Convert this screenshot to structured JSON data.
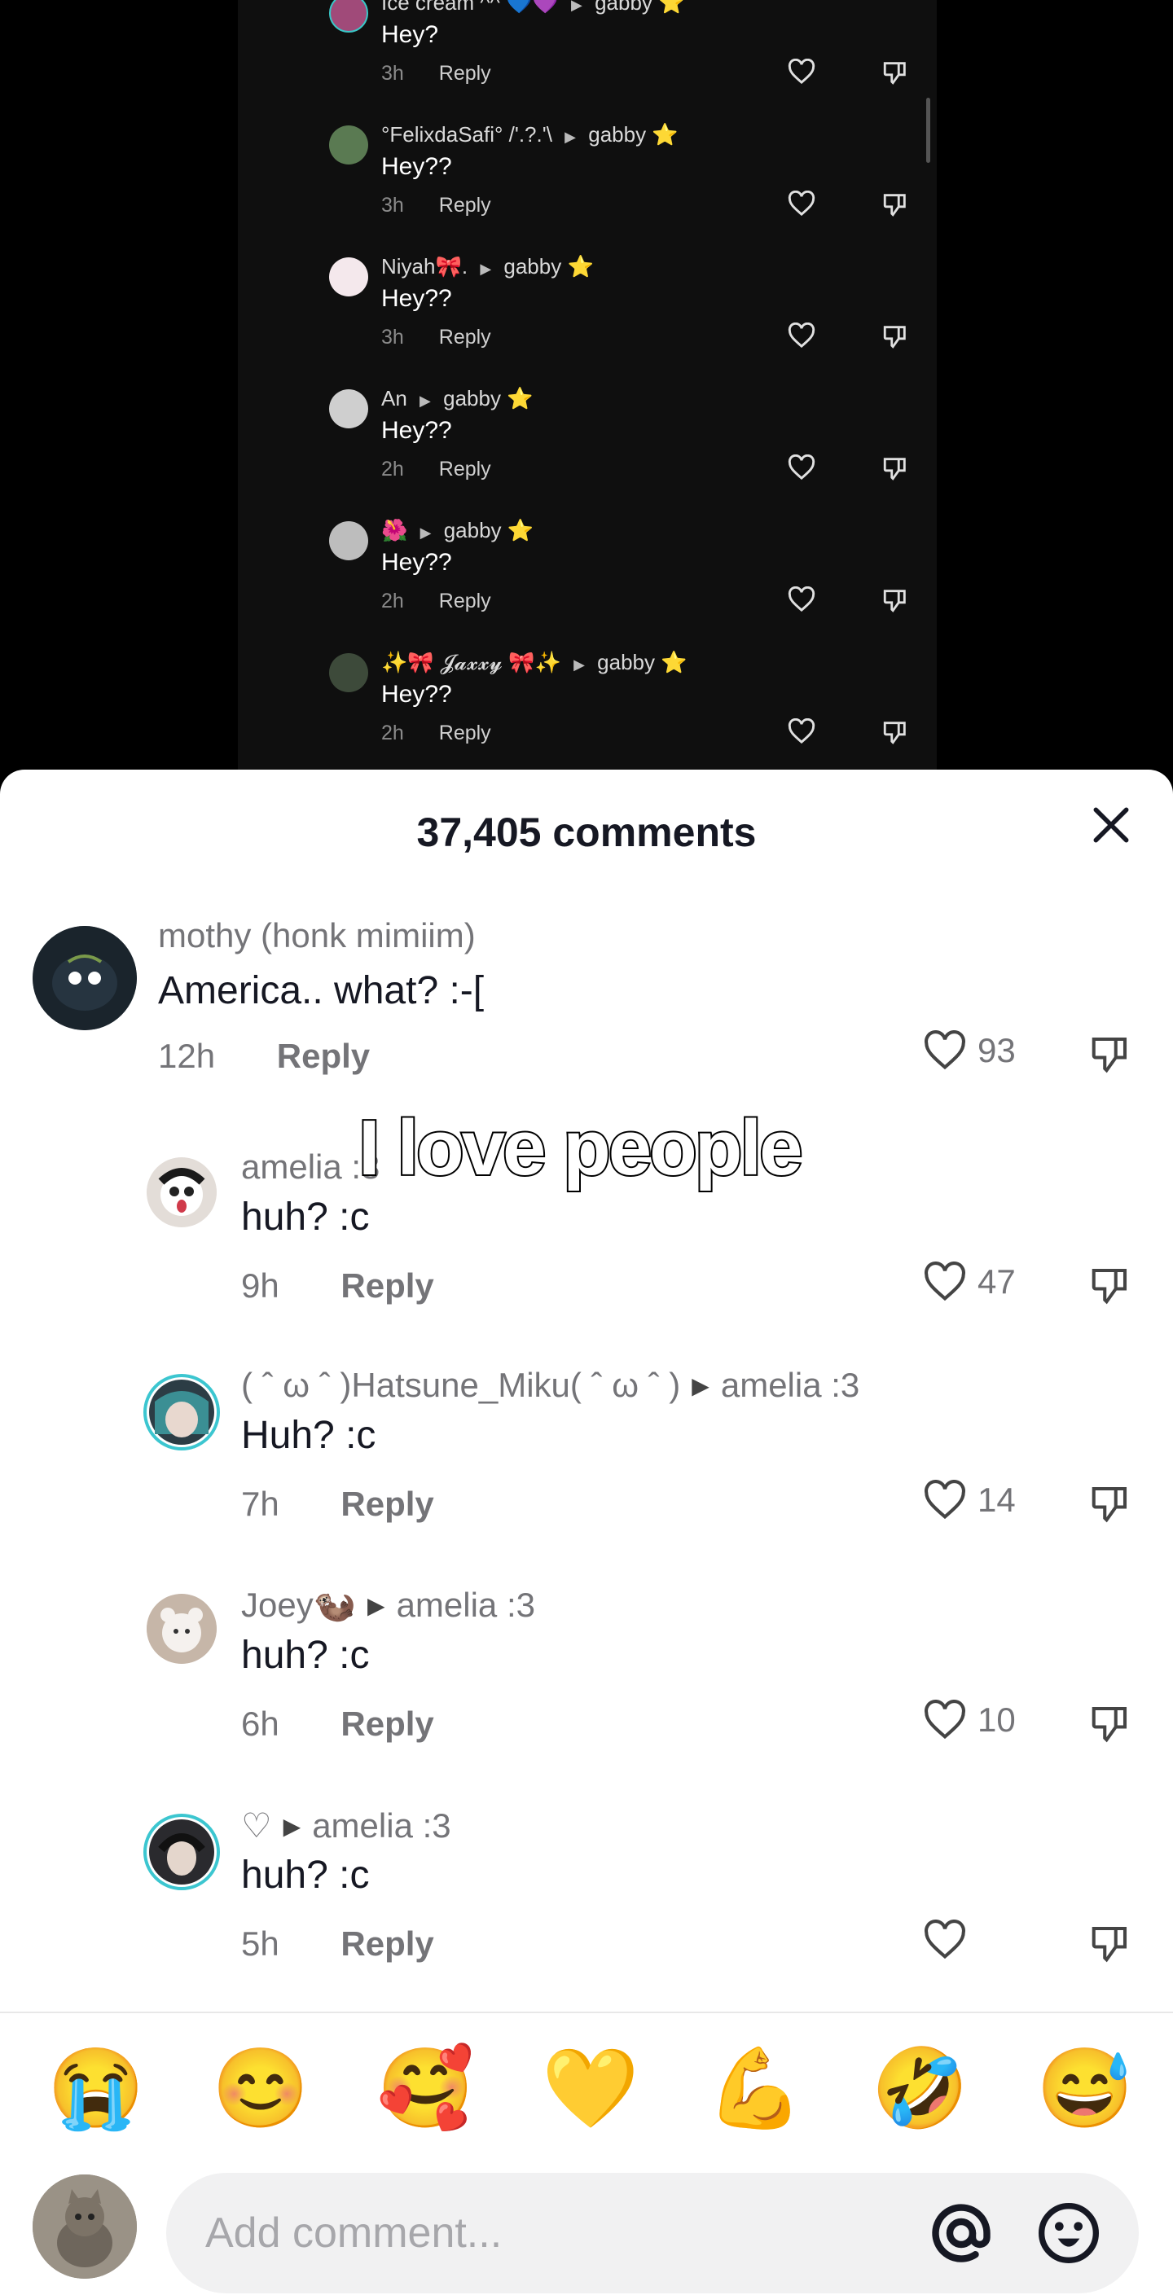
{
  "video": {
    "comments": [
      {
        "name": "Ice cream ^^",
        "badge": "💙💜",
        "to": "gabby",
        "to_badge": "⭐",
        "text": "Hey?",
        "time": "3h",
        "reply": "Reply"
      },
      {
        "name": "°FelixdaSafi° /'.?.'\\",
        "badge": "",
        "to": "gabby",
        "to_badge": "⭐",
        "text": "Hey??",
        "time": "3h",
        "reply": "Reply"
      },
      {
        "name": "Niyah🎀.",
        "badge": "",
        "to": "gabby",
        "to_badge": "⭐",
        "text": "Hey??",
        "time": "3h",
        "reply": "Reply"
      },
      {
        "name": "An",
        "badge": "",
        "to": "gabby",
        "to_badge": "⭐",
        "text": "Hey??",
        "time": "2h",
        "reply": "Reply"
      },
      {
        "name": "🌺",
        "badge": "",
        "to": "gabby",
        "to_badge": "⭐",
        "text": "Hey??",
        "time": "2h",
        "reply": "Reply"
      },
      {
        "name": "✨🎀 𝓙𝓪𝔁𝔁𝔂 🎀✨",
        "badge": "",
        "to": "gabby",
        "to_badge": "⭐",
        "text": "Hey??",
        "time": "2h",
        "reply": "Reply"
      }
    ]
  },
  "sheet": {
    "title": "37,405 comments",
    "overlay_text": "I love people",
    "comments": [
      {
        "name": "mothy (honk mimiim)",
        "to": "",
        "text": "America.. what? :-[",
        "time": "12h",
        "reply": "Reply",
        "likes": "93"
      },
      {
        "name": "amelia :3",
        "to": "",
        "text": "huh? :c",
        "time": "9h",
        "reply": "Reply",
        "likes": "47"
      },
      {
        "name": "( ˆ ω ˆ )Hatsune_Miku( ˆ ω ˆ )",
        "to": "amelia :3",
        "text": "Huh? :c",
        "time": "7h",
        "reply": "Reply",
        "likes": "14"
      },
      {
        "name": "Joey🦦",
        "to": "amelia :3",
        "text": "huh? :c",
        "time": "6h",
        "reply": "Reply",
        "likes": "10"
      },
      {
        "name": "♡",
        "to": "amelia :3",
        "text": "huh? :c",
        "time": "5h",
        "reply": "Reply",
        "likes": ""
      }
    ],
    "emojis": [
      "😭",
      "😊",
      "🥰",
      "💛",
      "💪",
      "🤣",
      "😅"
    ],
    "input": {
      "placeholder": "Add comment..."
    }
  }
}
